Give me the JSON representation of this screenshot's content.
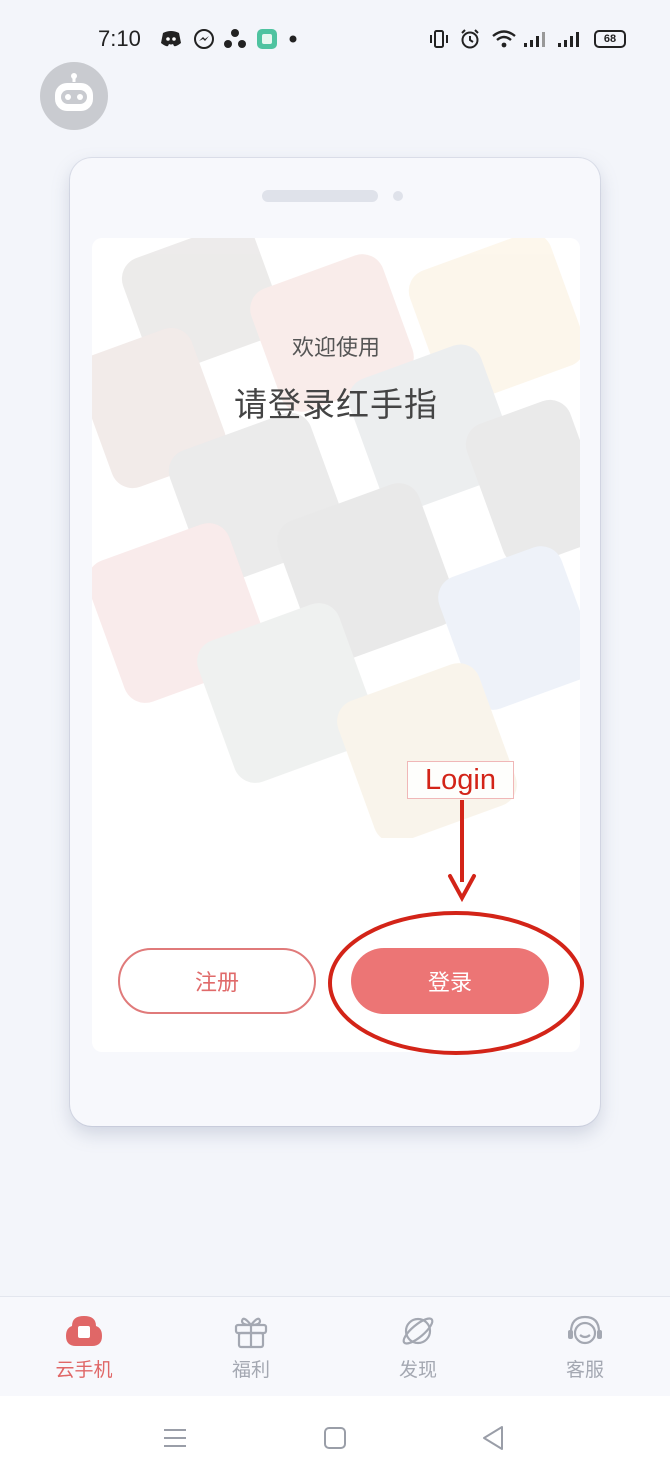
{
  "status_bar": {
    "time": "7:10",
    "battery": "68",
    "notification_icons": [
      "discord-icon",
      "messenger-icon",
      "sync-icon",
      "app-icon",
      "dot-icon"
    ],
    "system_icons": [
      "vibrate-icon",
      "alarm-icon",
      "wifi-icon",
      "signal-icon",
      "signal-icon"
    ]
  },
  "main": {
    "welcome_text": "欢迎使用",
    "title": "请登录红手指",
    "register_button": "注册",
    "login_button": "登录"
  },
  "annotation": {
    "label": "Login",
    "color": "#d32418"
  },
  "tab_bar": {
    "tabs": [
      {
        "label": "云手机",
        "icon": "cloud-phone-icon",
        "active": true
      },
      {
        "label": "福利",
        "icon": "gift-icon",
        "active": false
      },
      {
        "label": "发现",
        "icon": "planet-icon",
        "active": false
      },
      {
        "label": "客服",
        "icon": "headset-icon",
        "active": false
      }
    ]
  },
  "nav_bar": {
    "buttons": [
      "menu-icon",
      "home-icon",
      "back-icon"
    ]
  },
  "colors": {
    "accent": "#ec7575",
    "background": "#f3f5fa",
    "inactive": "#a4a8b2"
  }
}
